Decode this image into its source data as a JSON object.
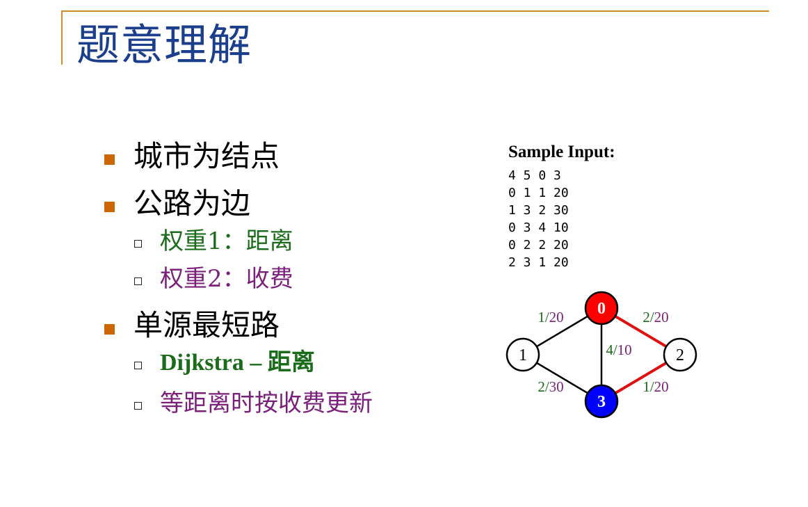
{
  "slide": {
    "title": "题意理解"
  },
  "bullets": [
    {
      "text": "城市为结点"
    },
    {
      "text": "公路为边",
      "sub": [
        {
          "text": "权重1：距离",
          "color": "#1a6b1a"
        },
        {
          "text": "权重2：收费",
          "color": "#7a1f7a"
        }
      ]
    },
    {
      "text": "单源最短路",
      "sub": [
        {
          "text": "Dijkstra – 距离",
          "color": "#1a6b1a"
        },
        {
          "text": "等距离时按收费更新",
          "color": "#7a1f7a"
        }
      ]
    }
  ],
  "sample": {
    "title": "Sample Input:",
    "lines": [
      "4 5 0 3",
      "0 1 1 20",
      "1 3 2 30",
      "0 3 4 10",
      "0 2 2 20",
      "2 3 1 20"
    ]
  },
  "graph": {
    "nodes": [
      {
        "id": "0",
        "fill": "#ff0000",
        "text_color": "#ffffff"
      },
      {
        "id": "1",
        "fill": "#ffffff",
        "text_color": "#000000"
      },
      {
        "id": "2",
        "fill": "#ffffff",
        "text_color": "#000000"
      },
      {
        "id": "3",
        "fill": "#0000ff",
        "text_color": "#ffffff"
      }
    ],
    "edges": [
      {
        "from": "0",
        "to": "1",
        "dist": "1",
        "cost": "20",
        "highlight": false
      },
      {
        "from": "0",
        "to": "2",
        "dist": "2",
        "cost": "20",
        "highlight": true
      },
      {
        "from": "0",
        "to": "3",
        "dist": "4",
        "cost": "10",
        "highlight": false
      },
      {
        "from": "1",
        "to": "3",
        "dist": "2",
        "cost": "30",
        "highlight": false
      },
      {
        "from": "2",
        "to": "3",
        "dist": "1",
        "cost": "20",
        "highlight": true
      }
    ],
    "colors": {
      "dist": "#1a6b1a",
      "cost": "#7a1f7a",
      "highlight": "#e01010",
      "normal": "#000000"
    }
  }
}
